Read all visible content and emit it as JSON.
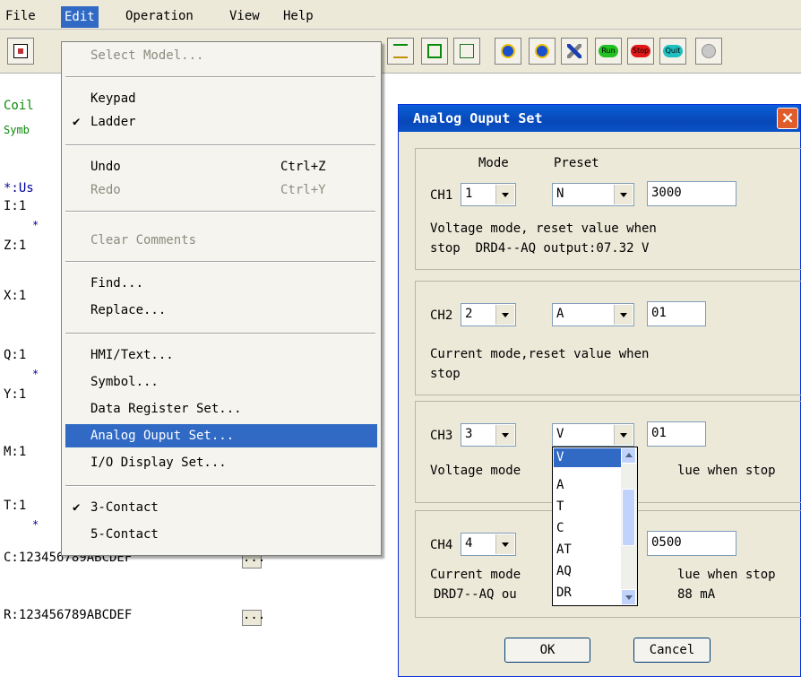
{
  "menubar": {
    "file": "File",
    "edit": "Edit",
    "operation": "Operation",
    "view": "View",
    "help": "Help"
  },
  "toolbar": {
    "run": "Run",
    "stop": "Stop",
    "quit": "Quit"
  },
  "main": {
    "coil": "Coil",
    "symb": "Symb",
    "us": "*:Us",
    "i": "I:1",
    "z": "Z:1",
    "x": "X:1",
    "q": "Q:1",
    "y": "Y:1",
    "m": "M:1",
    "t": "T:1",
    "c": "C:123456789ABCDEF",
    "r": "R:123456789ABCDEF",
    "star": "*",
    "dots": "..."
  },
  "edit_menu": {
    "select_model": "Select Model...",
    "keypad": "Keypad",
    "ladder": "Ladder",
    "undo": "Undo",
    "undo_sc": "Ctrl+Z",
    "redo": "Redo",
    "redo_sc": "Ctrl+Y",
    "clear_comments": "Clear Comments",
    "find": "Find...",
    "replace": "Replace...",
    "hmi_text": "HMI/Text...",
    "symbol": "Symbol...",
    "data_register_set": "Data Register Set...",
    "analog_ouput_set": "Analog Ouput Set...",
    "io_display_set": "I/O Display Set...",
    "three_contact": "3-Contact",
    "five_contact": "5-Contact",
    "check": "✔"
  },
  "dialog": {
    "title": "Analog Ouput Set",
    "close": "×",
    "mode_header": "Mode",
    "preset_header": "Preset",
    "ch1": {
      "label": "CH1",
      "mode": "1",
      "preset": "N",
      "value": "3000",
      "desc1": "Voltage mode, reset value when",
      "desc2": "stop  DRD4--AQ output:07.32 V"
    },
    "ch2": {
      "label": "CH2",
      "mode": "2",
      "preset": "A",
      "value": "01",
      "desc1": "Current mode,reset value when",
      "desc2": "stop"
    },
    "ch3": {
      "label": "CH3",
      "mode": "3",
      "preset": "V",
      "value": "01",
      "desc1_a": "Voltage mode",
      "desc1_b": "lue when stop"
    },
    "ch4": {
      "label": "CH4",
      "mode": "4",
      "value": "0500",
      "desc1_a": "Current mode",
      "desc1_b": "lue when stop",
      "desc2_a": "DRD7--AQ ou",
      "desc2_b": "88 mA"
    },
    "ok": "OK",
    "cancel": "Cancel"
  },
  "dropdown": {
    "options": [
      "V",
      "A",
      "T",
      "C",
      "AT",
      "AQ",
      "DR"
    ],
    "selected": "V"
  }
}
